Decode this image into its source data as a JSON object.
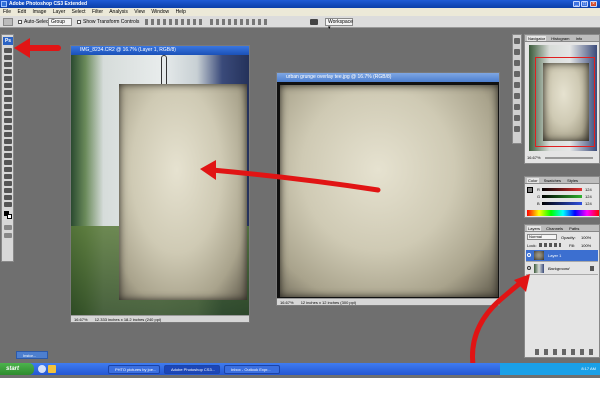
{
  "app": {
    "title": "Adobe Photoshop CS3 Extended"
  },
  "menu": [
    "File",
    "Edit",
    "Image",
    "Layer",
    "Select",
    "Filter",
    "Analysis",
    "View",
    "Window",
    "Help"
  ],
  "options_bar": {
    "auto_select_label": "Auto-Select",
    "auto_select_value": "Group",
    "show_transform_label": "Show Transform Controls",
    "workspace_label": "Workspace ▾"
  },
  "toolbox": {
    "badge": "Ps"
  },
  "documents": [
    {
      "title": "IMG_8234.CR2 @ 16.7% (Layer 1, RGB/8)",
      "zoom": "16.67%",
      "status": "12.333 inches x 18.2 inches (240 ppi)"
    },
    {
      "title": "urban grunge overlay tee.jpg @ 16.7% (RGB/8)",
      "zoom": "16.67%",
      "status": "12 inches x 12 inches (300 ppi)"
    }
  ],
  "navigator": {
    "tabs": [
      "Navigator",
      "Histogram",
      "Info"
    ],
    "zoom": "16.67%"
  },
  "color_panel": {
    "tabs": [
      "Color",
      "Swatches",
      "Styles"
    ],
    "channels": [
      {
        "label": "R",
        "value": "124",
        "color": "#e03030"
      },
      {
        "label": "G",
        "value": "124",
        "color": "#30b030"
      },
      {
        "label": "B",
        "value": "124",
        "color": "#3050e0"
      }
    ]
  },
  "layers_panel": {
    "tabs": [
      "Layers",
      "Channels",
      "Paths"
    ],
    "blend_mode": "Normal",
    "opacity_label": "Opacity:",
    "opacity_value": "100%",
    "lock_label": "Lock:",
    "fill_label": "Fill:",
    "fill_value": "100%",
    "layers": [
      {
        "name": "Layer 1",
        "selected": true
      },
      {
        "name": "Background",
        "selected": false
      }
    ]
  },
  "minimized_doc": "Instor...",
  "taskbar": {
    "start_label": "start",
    "buttons": [
      {
        "label": "PHTO pictures by joe..."
      },
      {
        "label": "Adobe Photoshop CS3..."
      },
      {
        "label": "Inbox - Outlook Expr..."
      }
    ],
    "clock": "8:17 AM"
  },
  "annotation_colors": {
    "arrow": "#e11414"
  }
}
